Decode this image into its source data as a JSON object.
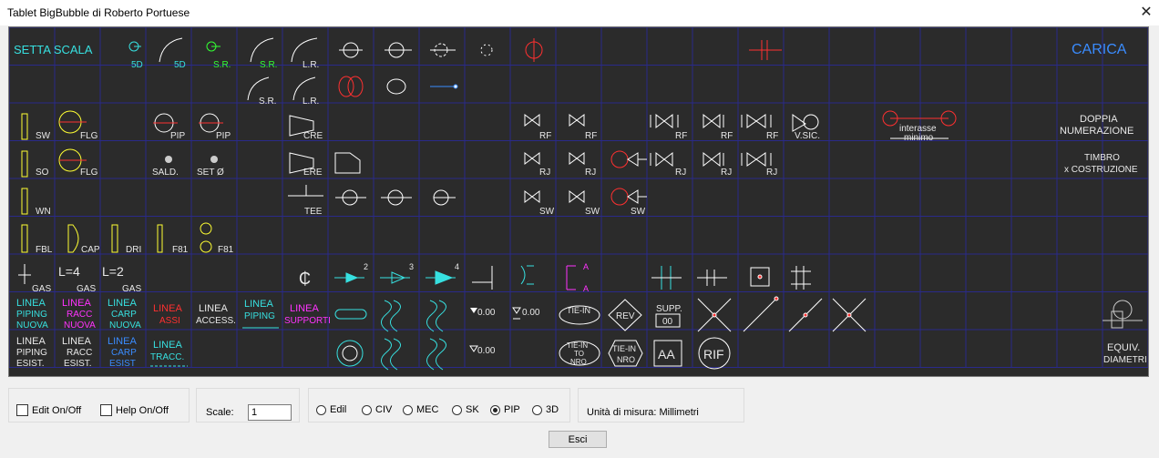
{
  "window": {
    "title": "Tablet BigBubble di Roberto Portuese",
    "close_icon": "close-icon"
  },
  "colors": {
    "tablet_bg": "#2b2b2b",
    "grid": "#2a2a8a",
    "cyan": "#37e0e0",
    "white": "#e8e8e8",
    "yellow": "#ffff33",
    "red": "#ff3030",
    "magenta": "#ff33ff",
    "blue": "#3a8cff",
    "green": "#33ff33"
  },
  "tablet": {
    "row1": [
      "SETTA  SCALA",
      "5D",
      "5D",
      "S.R.",
      "S.R.",
      "L.R.",
      "CARICA"
    ],
    "row2": [
      "S.R.",
      "L.R."
    ],
    "row3": [
      "SW",
      "FLG",
      "PIP",
      "PIP",
      "CRE",
      "RF",
      "RF",
      "RF",
      "RF",
      "RF",
      "V.SIC.",
      "interasse",
      "minimo",
      "DOPPIA",
      "NUMERAZIONE"
    ],
    "row4": [
      "SO",
      "FLG",
      "SALD.",
      "SET Ø",
      "ERE",
      "RJ",
      "RJ",
      "RJ",
      "RJ",
      "RJ",
      "TIMBRO",
      "x COSTRUZIONE"
    ],
    "row5": [
      "WN",
      "TEE",
      "SW",
      "SW",
      "SW"
    ],
    "row6": [
      "FBL",
      "CAP",
      "DRI",
      "F81",
      "F81"
    ],
    "row7": [
      "GAS",
      "L=4",
      "GAS",
      "L=2",
      "GAS",
      "2",
      "3",
      "4",
      "A",
      "A"
    ],
    "row8": [
      "LINEA",
      "PIPING",
      "NUOVA",
      "LINEA",
      "RACC",
      "NUOVA",
      "LINEA",
      "CARP",
      "NUOVA",
      "LINEA",
      "ASSI",
      "LINEA",
      "ACCESS.",
      "LINEA",
      "PIPING",
      "LINEA",
      "SUPPORTI",
      "0.00",
      "0.00",
      "TIE-IN",
      "REV",
      "SUPP.",
      "00"
    ],
    "row9": [
      "LINEA",
      "PIPING",
      "ESIST.",
      "LINEA",
      "RACC",
      "ESIST.",
      "LINEA",
      "CARP",
      "ESIST",
      "LINEA",
      "TRACC.",
      "0.00",
      "TIE-IN",
      "TO",
      "NRO",
      "TIE-IN",
      "NRO",
      "AA",
      "RIF",
      "EQUIV.",
      "DIAMETRI"
    ]
  },
  "options": {
    "edit_label": "Edit On/Off",
    "help_label": "Help On/Off",
    "scale_label": "Scale:",
    "scale_value": "1",
    "radios": [
      "Edil",
      "CIV",
      "MEC",
      "SK",
      "PIP",
      "3D"
    ],
    "selected": "PIP",
    "units_label": "Unità di misura: Millimetri",
    "exit_label": "Esci"
  }
}
